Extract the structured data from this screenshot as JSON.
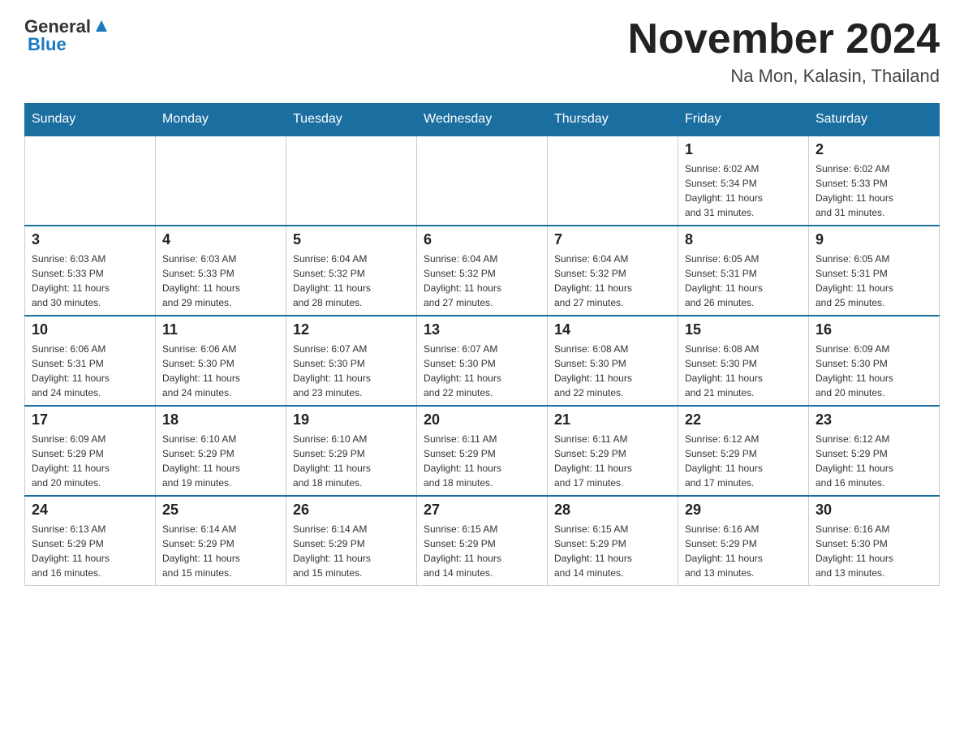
{
  "header": {
    "logo_text_general": "General",
    "logo_text_blue": "Blue",
    "month_title": "November 2024",
    "location": "Na Mon, Kalasin, Thailand"
  },
  "days_of_week": [
    "Sunday",
    "Monday",
    "Tuesday",
    "Wednesday",
    "Thursday",
    "Friday",
    "Saturday"
  ],
  "weeks": [
    {
      "days": [
        {
          "number": "",
          "info": ""
        },
        {
          "number": "",
          "info": ""
        },
        {
          "number": "",
          "info": ""
        },
        {
          "number": "",
          "info": ""
        },
        {
          "number": "",
          "info": ""
        },
        {
          "number": "1",
          "info": "Sunrise: 6:02 AM\nSunset: 5:34 PM\nDaylight: 11 hours\nand 31 minutes."
        },
        {
          "number": "2",
          "info": "Sunrise: 6:02 AM\nSunset: 5:33 PM\nDaylight: 11 hours\nand 31 minutes."
        }
      ]
    },
    {
      "days": [
        {
          "number": "3",
          "info": "Sunrise: 6:03 AM\nSunset: 5:33 PM\nDaylight: 11 hours\nand 30 minutes."
        },
        {
          "number": "4",
          "info": "Sunrise: 6:03 AM\nSunset: 5:33 PM\nDaylight: 11 hours\nand 29 minutes."
        },
        {
          "number": "5",
          "info": "Sunrise: 6:04 AM\nSunset: 5:32 PM\nDaylight: 11 hours\nand 28 minutes."
        },
        {
          "number": "6",
          "info": "Sunrise: 6:04 AM\nSunset: 5:32 PM\nDaylight: 11 hours\nand 27 minutes."
        },
        {
          "number": "7",
          "info": "Sunrise: 6:04 AM\nSunset: 5:32 PM\nDaylight: 11 hours\nand 27 minutes."
        },
        {
          "number": "8",
          "info": "Sunrise: 6:05 AM\nSunset: 5:31 PM\nDaylight: 11 hours\nand 26 minutes."
        },
        {
          "number": "9",
          "info": "Sunrise: 6:05 AM\nSunset: 5:31 PM\nDaylight: 11 hours\nand 25 minutes."
        }
      ]
    },
    {
      "days": [
        {
          "number": "10",
          "info": "Sunrise: 6:06 AM\nSunset: 5:31 PM\nDaylight: 11 hours\nand 24 minutes."
        },
        {
          "number": "11",
          "info": "Sunrise: 6:06 AM\nSunset: 5:30 PM\nDaylight: 11 hours\nand 24 minutes."
        },
        {
          "number": "12",
          "info": "Sunrise: 6:07 AM\nSunset: 5:30 PM\nDaylight: 11 hours\nand 23 minutes."
        },
        {
          "number": "13",
          "info": "Sunrise: 6:07 AM\nSunset: 5:30 PM\nDaylight: 11 hours\nand 22 minutes."
        },
        {
          "number": "14",
          "info": "Sunrise: 6:08 AM\nSunset: 5:30 PM\nDaylight: 11 hours\nand 22 minutes."
        },
        {
          "number": "15",
          "info": "Sunrise: 6:08 AM\nSunset: 5:30 PM\nDaylight: 11 hours\nand 21 minutes."
        },
        {
          "number": "16",
          "info": "Sunrise: 6:09 AM\nSunset: 5:30 PM\nDaylight: 11 hours\nand 20 minutes."
        }
      ]
    },
    {
      "days": [
        {
          "number": "17",
          "info": "Sunrise: 6:09 AM\nSunset: 5:29 PM\nDaylight: 11 hours\nand 20 minutes."
        },
        {
          "number": "18",
          "info": "Sunrise: 6:10 AM\nSunset: 5:29 PM\nDaylight: 11 hours\nand 19 minutes."
        },
        {
          "number": "19",
          "info": "Sunrise: 6:10 AM\nSunset: 5:29 PM\nDaylight: 11 hours\nand 18 minutes."
        },
        {
          "number": "20",
          "info": "Sunrise: 6:11 AM\nSunset: 5:29 PM\nDaylight: 11 hours\nand 18 minutes."
        },
        {
          "number": "21",
          "info": "Sunrise: 6:11 AM\nSunset: 5:29 PM\nDaylight: 11 hours\nand 17 minutes."
        },
        {
          "number": "22",
          "info": "Sunrise: 6:12 AM\nSunset: 5:29 PM\nDaylight: 11 hours\nand 17 minutes."
        },
        {
          "number": "23",
          "info": "Sunrise: 6:12 AM\nSunset: 5:29 PM\nDaylight: 11 hours\nand 16 minutes."
        }
      ]
    },
    {
      "days": [
        {
          "number": "24",
          "info": "Sunrise: 6:13 AM\nSunset: 5:29 PM\nDaylight: 11 hours\nand 16 minutes."
        },
        {
          "number": "25",
          "info": "Sunrise: 6:14 AM\nSunset: 5:29 PM\nDaylight: 11 hours\nand 15 minutes."
        },
        {
          "number": "26",
          "info": "Sunrise: 6:14 AM\nSunset: 5:29 PM\nDaylight: 11 hours\nand 15 minutes."
        },
        {
          "number": "27",
          "info": "Sunrise: 6:15 AM\nSunset: 5:29 PM\nDaylight: 11 hours\nand 14 minutes."
        },
        {
          "number": "28",
          "info": "Sunrise: 6:15 AM\nSunset: 5:29 PM\nDaylight: 11 hours\nand 14 minutes."
        },
        {
          "number": "29",
          "info": "Sunrise: 6:16 AM\nSunset: 5:29 PM\nDaylight: 11 hours\nand 13 minutes."
        },
        {
          "number": "30",
          "info": "Sunrise: 6:16 AM\nSunset: 5:30 PM\nDaylight: 11 hours\nand 13 minutes."
        }
      ]
    }
  ]
}
